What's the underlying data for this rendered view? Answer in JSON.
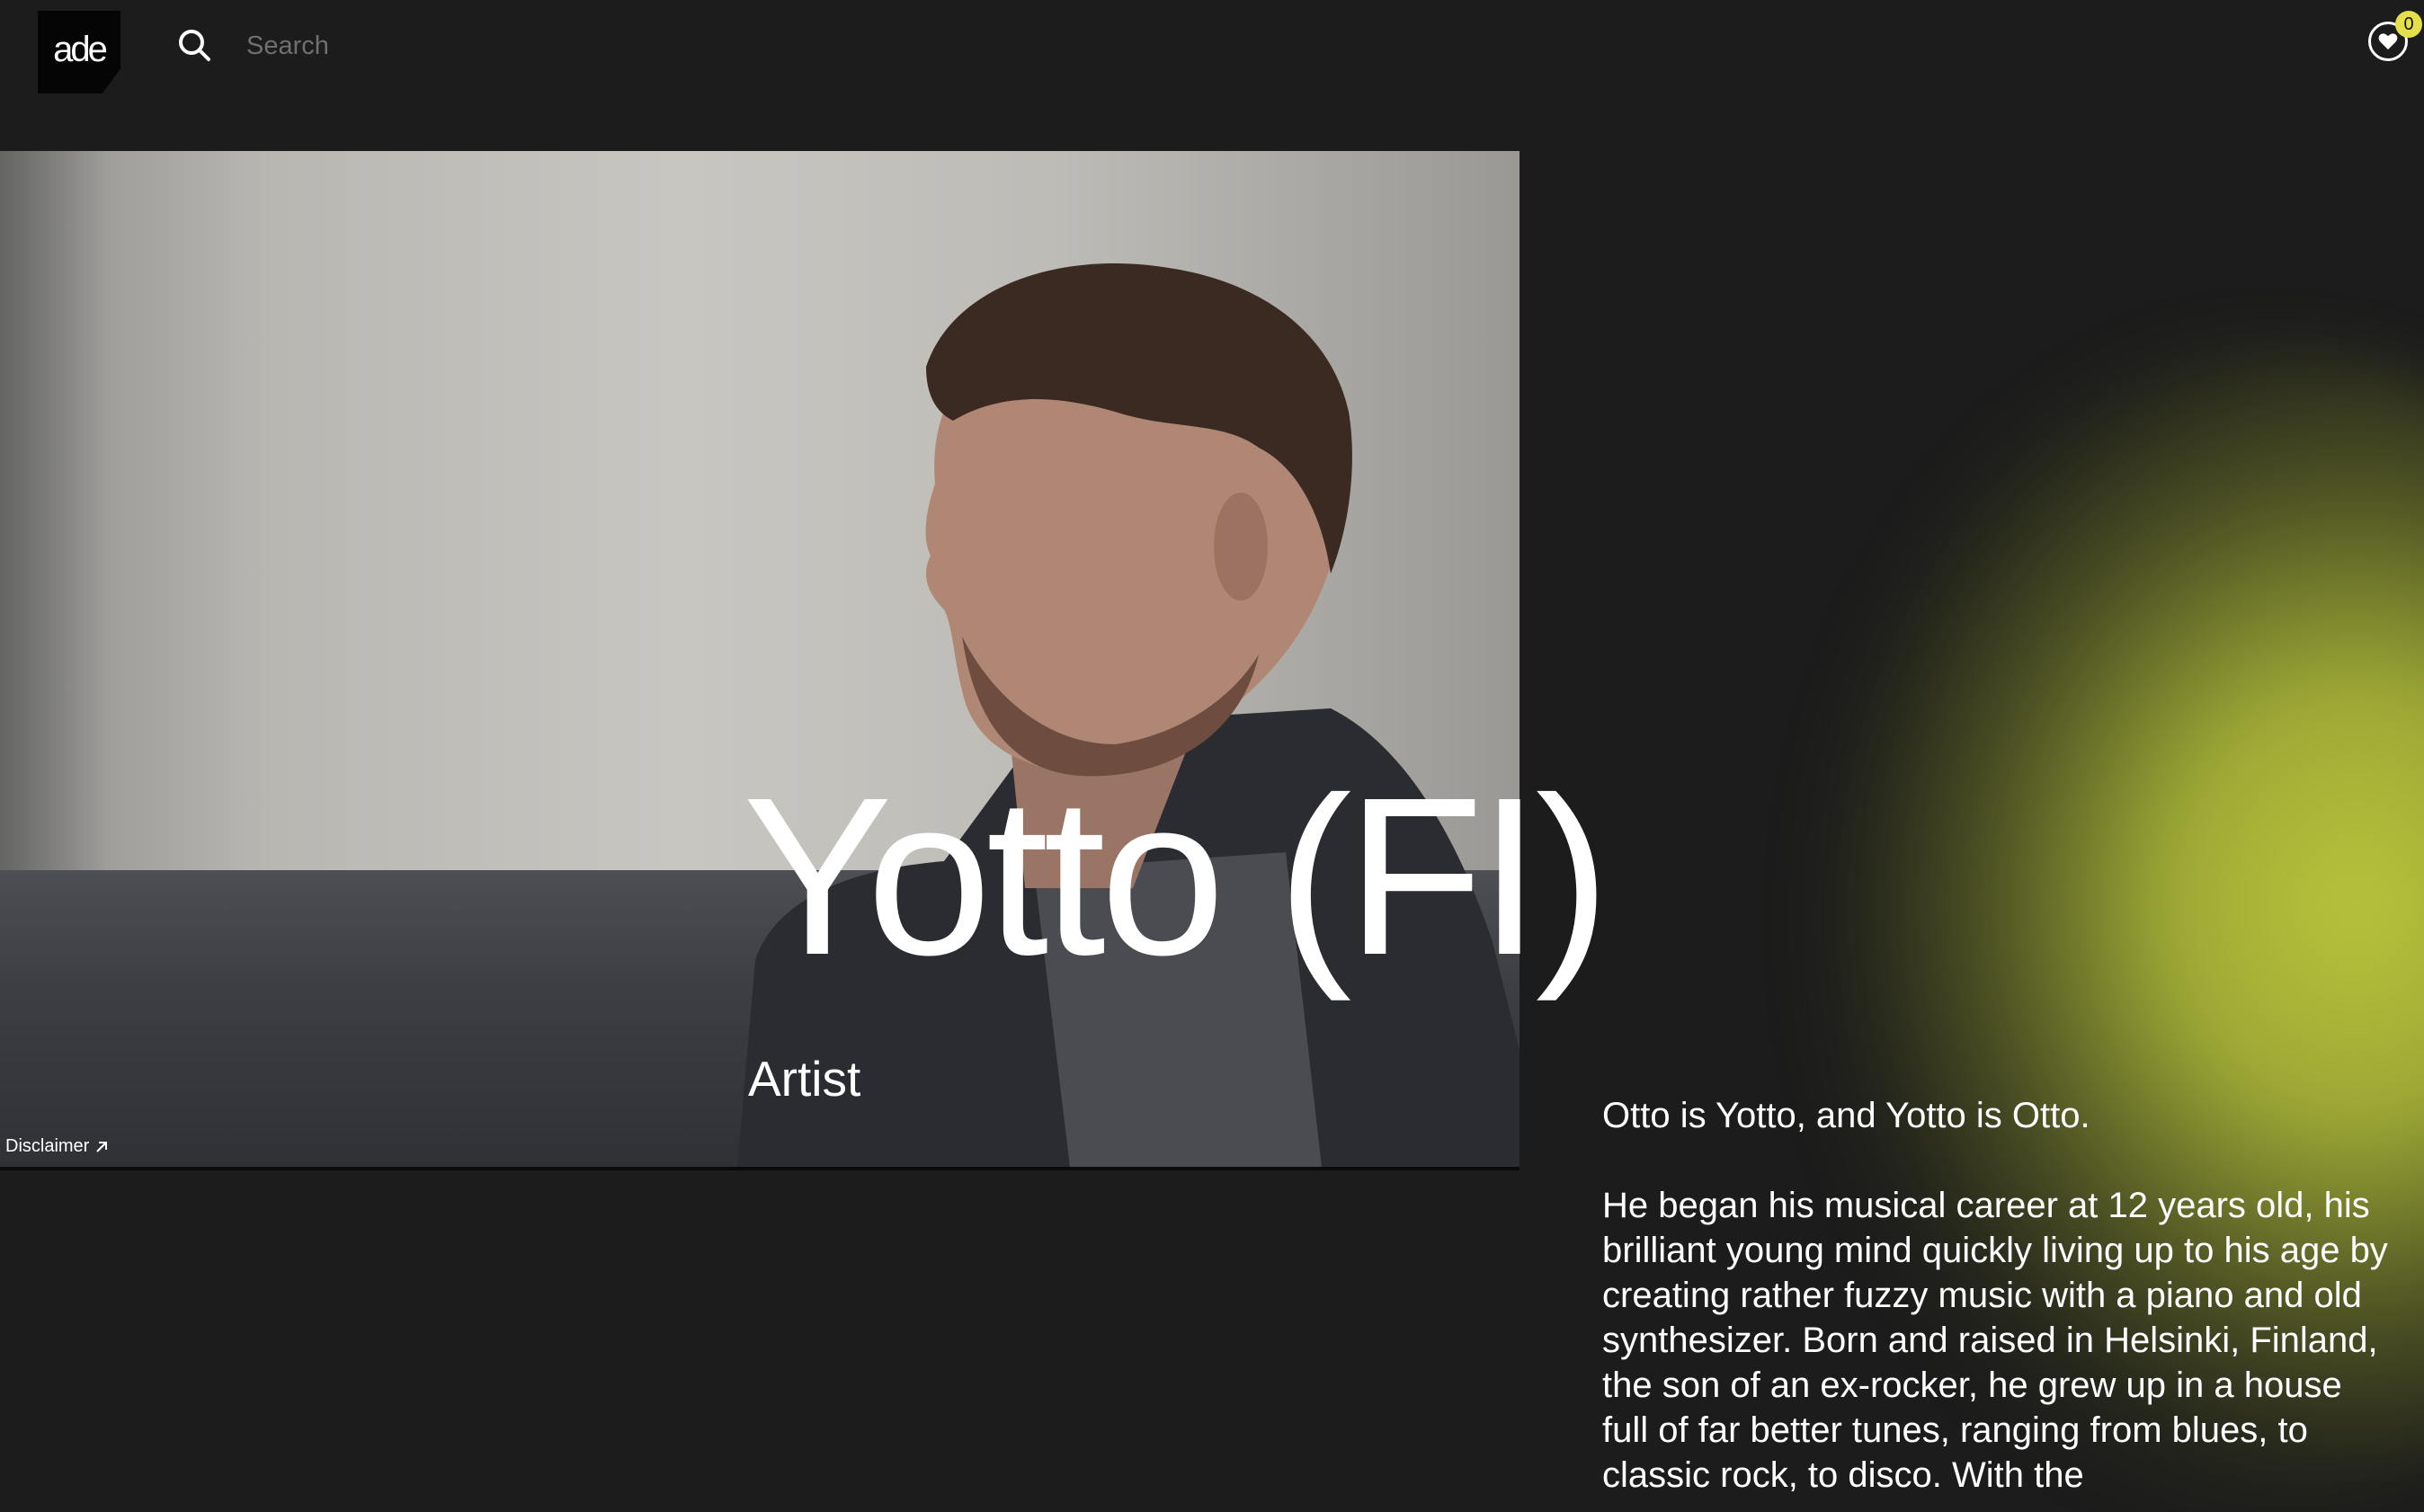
{
  "header": {
    "logo_text": "ade",
    "search_placeholder": "Search",
    "favorites_count": "0"
  },
  "hero": {
    "artist_name": "Yotto (FI)",
    "role": "Artist",
    "disclaimer_label": "Disclaimer",
    "disclaimer_icon": "arrow-up-right-icon"
  },
  "bio": {
    "paragraphs": [
      "Otto is Yotto, and Yotto is Otto.",
      "He began his musical career at 12 years old, his brilliant young mind quickly living up to his age by creating rather fuzzy music with a piano and old synthesizer. Born and raised in Helsinki, Finland, the son of an ex-rocker, he grew up in a house full of far better tunes, ranging from blues, to classic rock, to disco. With the"
    ]
  },
  "colors": {
    "background": "#1c1c1c",
    "accent_glow": "#b8c43c",
    "badge": "#e5e04a"
  },
  "icons": {
    "search": "search-icon",
    "favorites": "heart-icon"
  }
}
